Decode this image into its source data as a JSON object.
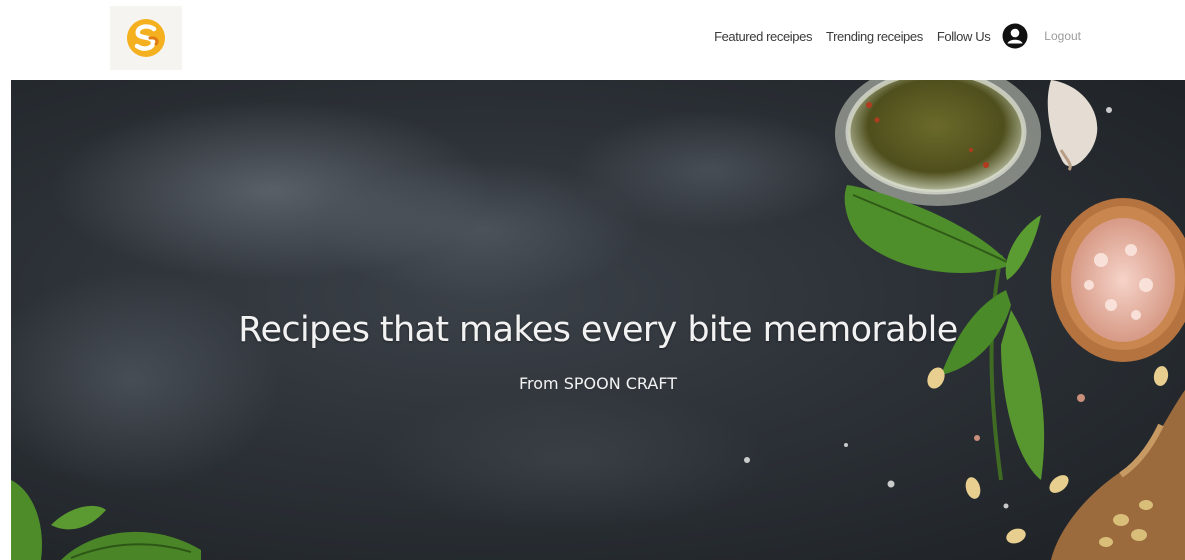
{
  "header": {
    "logo_icon": "spoon-craft-logo-icon",
    "brand_colors": {
      "primary": "#f2a91c",
      "secondary": "#e07b12"
    },
    "nav": [
      {
        "label": "Featured receipes"
      },
      {
        "label": "Trending receipes"
      },
      {
        "label": "Follow Us"
      }
    ],
    "user_icon": "user-avatar-icon",
    "logout_label": "Logout"
  },
  "hero": {
    "title": "Recipes that makes every bite memorable",
    "subtitle": "From SPOON CRAFT",
    "background_colors": {
      "slate_light": "#3b4148",
      "slate_dark": "#1d2125"
    },
    "decor_icons": [
      "herb-jar-icon",
      "garlic-icon",
      "basil-leaves-icon",
      "pink-salt-bowl-icon",
      "wooden-scoop-icon",
      "pine-nuts-icon"
    ]
  }
}
